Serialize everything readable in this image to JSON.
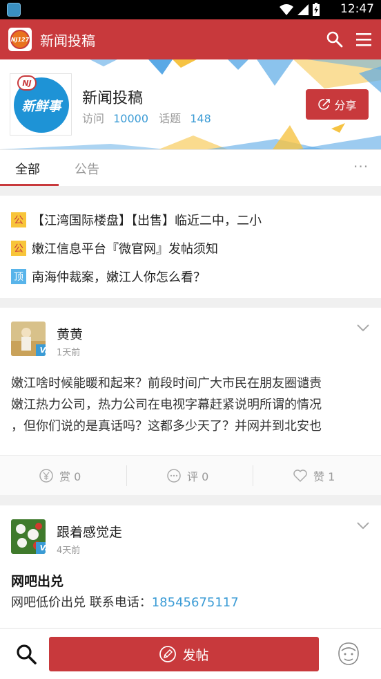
{
  "status_bar": {
    "time": "12:47"
  },
  "app_bar": {
    "logo_text": "NJ127",
    "title": "新闻投稿"
  },
  "profile": {
    "nj_badge": "NJ",
    "avatar_text": "新鲜事",
    "name": "新闻投稿",
    "visits_label": "访问",
    "visits_count": "10000",
    "topics_label": "话题",
    "topics_count": "148",
    "share_label": "分享"
  },
  "tabs": {
    "all": "全部",
    "notice": "公告",
    "more": "···"
  },
  "notices": [
    {
      "tag": "公",
      "text": "【江湾国际楼盘】【出售】临近二中，二小"
    },
    {
      "tag": "公",
      "text": "嫩江信息平台『微官网』发帖须知"
    },
    {
      "tag": "顶",
      "text": "南海仲裁案，嫩江人你怎么看？"
    }
  ],
  "posts": [
    {
      "user": "黄黄",
      "badge": "V.0",
      "time": "1天前",
      "lines": [
        "嫩江啥时候能暖和起来？前段时间广大市民在朋友圈谴责",
        "嫩江热力公司，热力公司在电视字幕赶紧说明所谓的情况",
        "，但你们说的是真话吗？这都多少天了？并网并到北安也"
      ],
      "reward": "赏 0",
      "comment": "评 0",
      "like": "赞 1"
    },
    {
      "user": "跟着感觉走",
      "badge": "V.0",
      "time": "4天前",
      "title": "网吧出兑",
      "body_text": "网吧低价出兑 联系电话：",
      "phone": "18545675117"
    }
  ],
  "bottom_bar": {
    "post_label": "发帖"
  },
  "colors": {
    "brand_red": "#c8393c",
    "link_blue": "#3a9bd5",
    "tag_yellow": "#f8c53a",
    "tag_blue": "#58b4ea"
  }
}
